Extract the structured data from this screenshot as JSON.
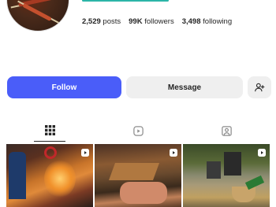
{
  "profile": {
    "stats": {
      "posts_value": "2,529",
      "posts_label": "posts",
      "followers_value": "99K",
      "followers_label": "followers",
      "following_value": "3,498",
      "following_label": "following"
    }
  },
  "actions": {
    "follow_label": "Follow",
    "message_label": "Message",
    "add_icon": "person-add-icon"
  },
  "tabs": [
    {
      "icon": "grid-icon",
      "active": true
    },
    {
      "icon": "reels-icon",
      "active": false
    },
    {
      "icon": "tagged-icon",
      "active": false
    }
  ],
  "grid": [
    {
      "type": "reel",
      "icon": "reel-icon"
    },
    {
      "type": "reel",
      "icon": "reel-icon"
    },
    {
      "type": "reel",
      "icon": "reel-icon"
    }
  ],
  "colors": {
    "accent": "#4a5df9",
    "secondary_button": "#efefef",
    "text": "#262626"
  }
}
